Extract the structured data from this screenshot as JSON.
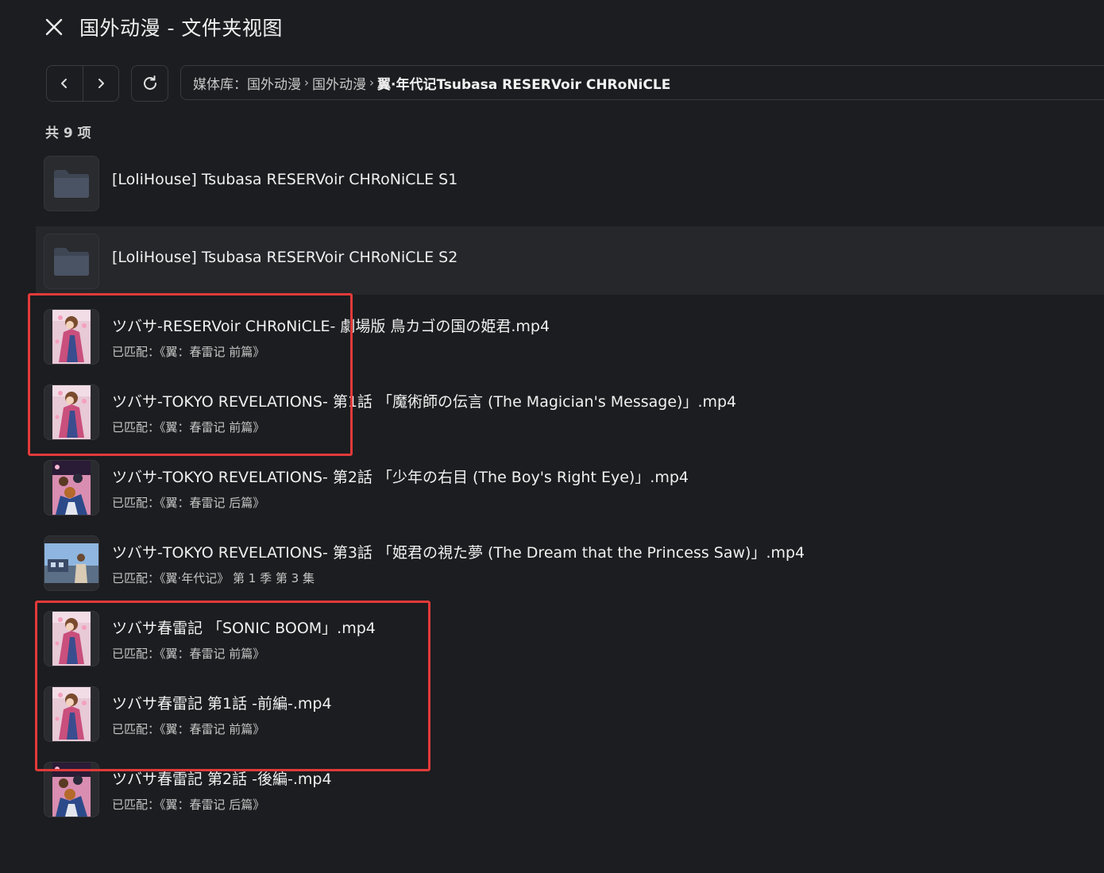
{
  "header": {
    "title": "国外动漫 - 文件夹视图",
    "close_icon": "close-icon"
  },
  "toolbar": {
    "back_icon": "chevron-left-icon",
    "forward_icon": "chevron-right-icon",
    "refresh_icon": "refresh-icon",
    "breadcrumb": [
      {
        "label": "媒体库：国外动漫"
      },
      {
        "label": "国外动漫"
      },
      {
        "label": "翼·年代记Tsubasa RESERVoir CHRoNiCLE"
      }
    ]
  },
  "count_label": "共 9 项",
  "items": [
    {
      "type": "folder",
      "name": "[LoliHouse] Tsubasa RESERVoir CHRoNiCLE S1",
      "sub": ""
    },
    {
      "type": "folder",
      "name": "[LoliHouse] Tsubasa RESERVoir CHRoNiCLE S2",
      "sub": ""
    },
    {
      "type": "video",
      "thumb": "pink",
      "name": "ツバサ-RESERVoir CHRoNiCLE- 劇場版 鳥カゴの国の姫君.mp4",
      "sub": "已匹配：《翼：春雷记 前篇》"
    },
    {
      "type": "video",
      "thumb": "pink",
      "name": "ツバサ-TOKYO REVELATIONS- 第1話 「魔術師の伝言 (The Magician's Message)」.mp4",
      "sub": "已匹配：《翼：春雷记 前篇》"
    },
    {
      "type": "video",
      "thumb": "group",
      "name": "ツバサ-TOKYO REVELATIONS- 第2話 「少年の右目 (The Boy's Right Eye)」.mp4",
      "sub": "已匹配：《翼：春雷记 后篇》"
    },
    {
      "type": "video",
      "thumb": "scene",
      "name": "ツバサ-TOKYO REVELATIONS- 第3話 「姫君の視た夢 (The Dream that the Princess Saw)」.mp4",
      "sub": "已匹配：《翼·年代记》 第 1 季 第 3 集"
    },
    {
      "type": "video",
      "thumb": "pink",
      "name": "ツバサ春雷記 「SONIC BOOM」.mp4",
      "sub": "已匹配：《翼：春雷记 前篇》"
    },
    {
      "type": "video",
      "thumb": "pink",
      "name": "ツバサ春雷記 第1話 -前編-.mp4",
      "sub": "已匹配：《翼：春雷记 前篇》"
    },
    {
      "type": "video",
      "thumb": "group",
      "name": "ツバサ春雷記 第2話 -後編-.mp4",
      "sub": "已匹配：《翼：春雷记 后篇》"
    }
  ],
  "colors": {
    "background": "#1c1d20",
    "highlight": "#e23a3a",
    "hover_row": "#26272b"
  }
}
